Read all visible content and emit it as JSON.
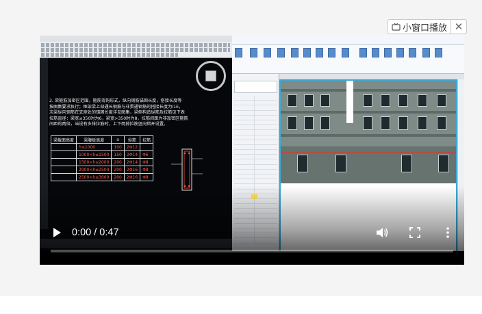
{
  "mini_player": {
    "label": "小窗口播放",
    "icon": "tv-icon",
    "close_icon": "close-icon"
  },
  "video": {
    "time_display": "0:00 / 0:47",
    "progress": 0.0,
    "controls": {
      "play_icon": "play-icon",
      "volume_icon": "volume-icon",
      "fullscreen_icon": "fullscreen-icon",
      "more_icon": "more-vertical-icon"
    }
  },
  "colors": {
    "accent_view_border": "#3ca9d6",
    "cad_background": "#05070a",
    "cad_table_text": "#ff5a4a"
  },
  "cad_screen": {
    "notes": "2. 梁箍筋加密区范围，箍筋弯钩形式，纵向钢筋锚固长度，搭接长度等\n按图集要求执行；框架梁上部通长钢筋与非贯通钢筋的搭接长度为l1E，\n次梁纵向钢筋在支座处的锚固长度详见图集，梁侧构造纵筋及拉筋见下表\n拉筋直径：梁宽≤350时为6，梁宽>350时为8，拉筋间距为非加密区箍筋\n间距的两倍，当设有多排拉筋时，上下两排拉筋竖向错开设置。",
    "table": {
      "headers": [
        "梁截面高度",
        "梁腹板高度",
        "a",
        "纵筋",
        "拉筋"
      ],
      "rows": [
        [
          "",
          "h≤1000",
          "100",
          "2Φ12",
          ""
        ],
        [
          "",
          "1000<h≤1500",
          "150",
          "2Φ14",
          "Φ6"
        ],
        [
          "",
          "1500<h≤2000",
          "200",
          "2Φ14",
          "Φ8"
        ],
        [
          "",
          "2000<h≤2500",
          "200",
          "2Φ16",
          "Φ8"
        ],
        [
          "",
          "2500<h≤3000",
          "200",
          "2Φ16",
          "Φ8"
        ]
      ]
    }
  }
}
